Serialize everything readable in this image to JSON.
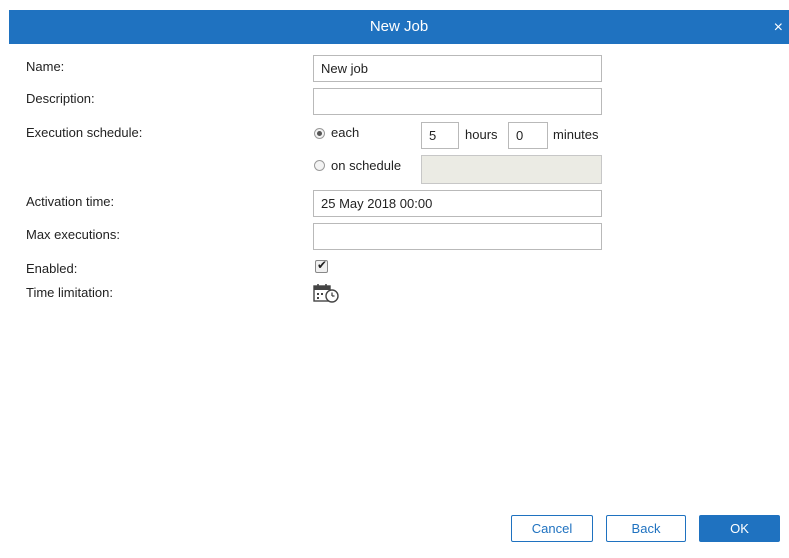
{
  "dialog": {
    "title": "New Job",
    "close_symbol": "×"
  },
  "form": {
    "name": {
      "label": "Name:",
      "value": "New job"
    },
    "description": {
      "label": "Description:",
      "value": ""
    },
    "execution_schedule": {
      "label": "Execution schedule:",
      "each_option": "each",
      "each_selected": true,
      "hours_value": "5",
      "hours_unit": "hours",
      "minutes_value": "0",
      "minutes_unit": "minutes",
      "on_schedule_option": "on schedule",
      "on_schedule_value": ""
    },
    "activation_time": {
      "label": "Activation time:",
      "value": "25 May 2018 00:00"
    },
    "max_executions": {
      "label": "Max executions:",
      "value": ""
    },
    "enabled": {
      "label": "Enabled:",
      "checked": true
    },
    "time_limitation": {
      "label": "Time limitation:",
      "icon": "calendar-clock-icon"
    }
  },
  "buttons": {
    "cancel": "Cancel",
    "back": "Back",
    "ok": "OK"
  },
  "colors": {
    "accent": "#1f72c0",
    "disabled_field": "#ebebe4"
  }
}
